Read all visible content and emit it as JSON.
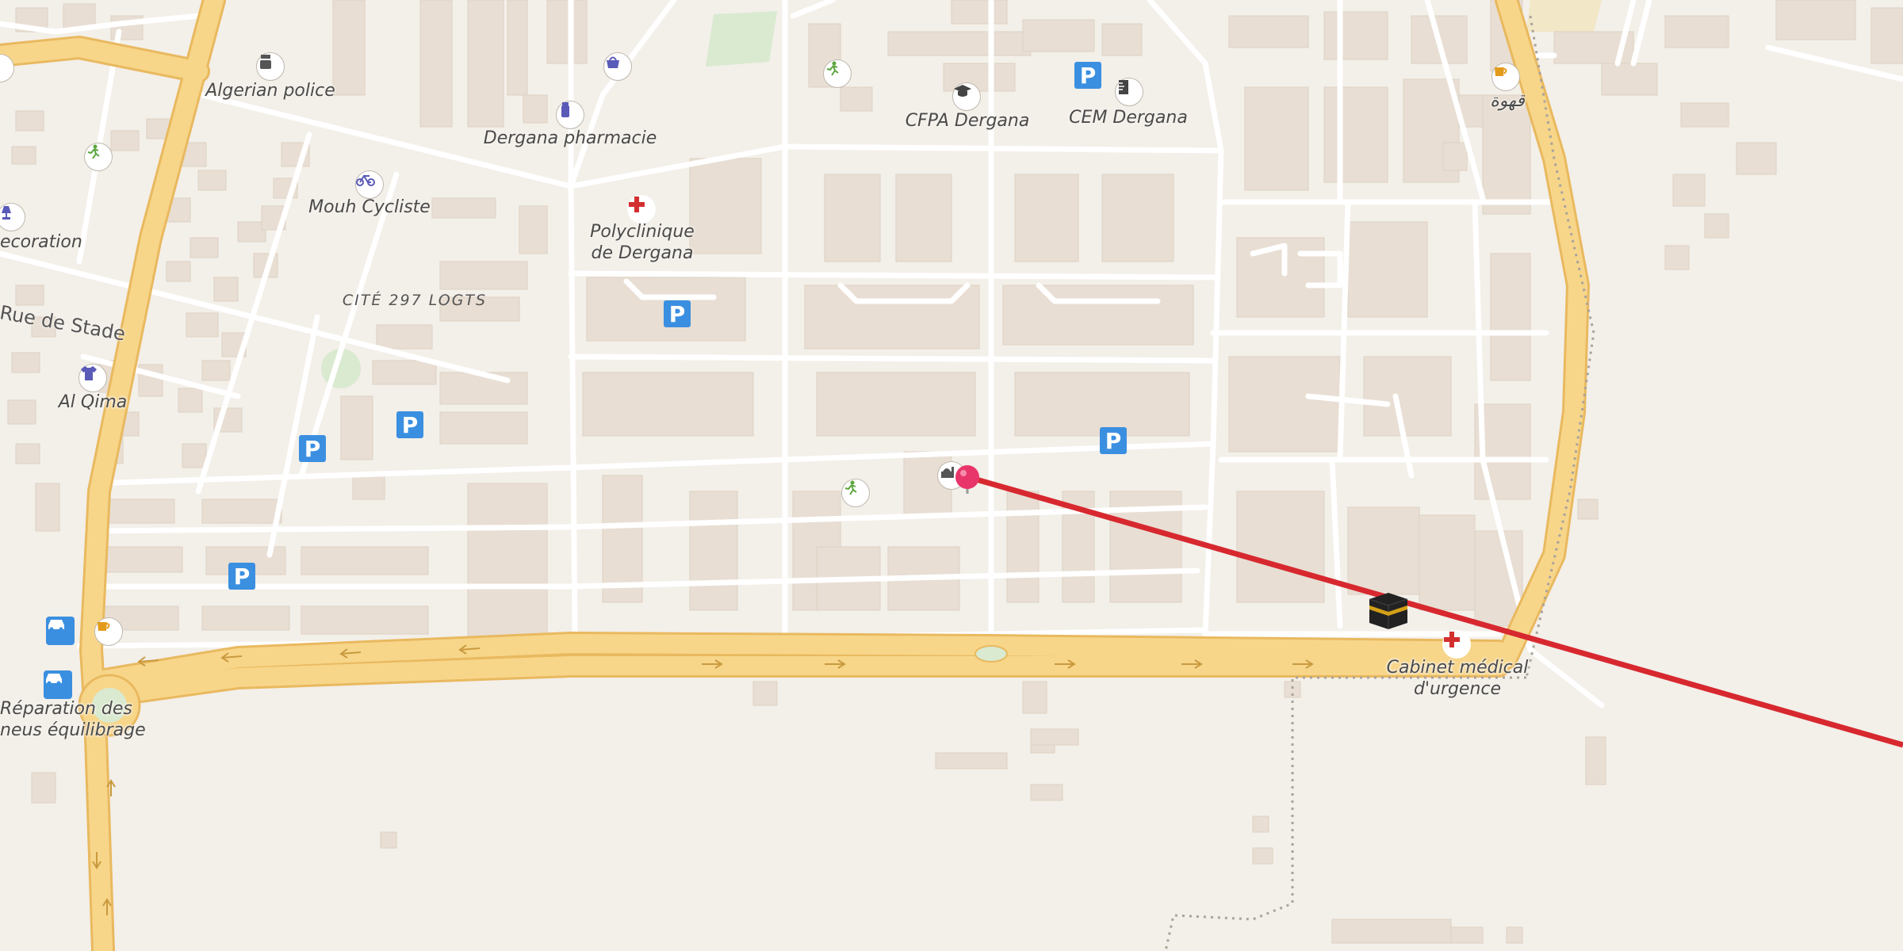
{
  "map": {
    "district_label": "CITÉ 297 LOGTS",
    "road_label": "Rue de Stade",
    "places": {
      "algerian_police": "Algerian police",
      "dergana_pharmacie": "Dergana pharmacie",
      "mouh_cycliste": "Mouh Cycliste",
      "polyclinique_line1": "Polyclinique",
      "polyclinique_line2": "de Dergana",
      "cfpa": "CFPA Dergana",
      "cem": "CEM Dergana",
      "cafe_arabic": "قهوة",
      "decoration": "ecoration",
      "al_qima": "Al Qima",
      "reparation_line1": "Réparation des",
      "reparation_line2": "neus équilibrage",
      "cabinet_line1": "Cabinet médical",
      "cabinet_line2": "d'urgence"
    },
    "icons": {
      "police": "police-icon",
      "pharmacy": "pharmacy-icon",
      "bicycle": "bicycle-icon",
      "clinic": "medical-cross-icon",
      "school": "graduation-cap-icon",
      "college": "ruler-icon",
      "cafe": "coffee-cup-icon",
      "lamp": "lamp-icon",
      "clothes": "shirt-icon",
      "sport": "running-person-icon",
      "shop": "shopping-basket-icon",
      "parking": "parking-icon",
      "car_repair": "car-icon",
      "mosque": "mosque-icon",
      "location_pin": "location-pin-icon",
      "qibla": "kaaba-icon"
    },
    "parking_letter": "P",
    "colors": {
      "background": "#f3efe9",
      "building": "#e8ded3",
      "major_road": "#f7d68a",
      "major_road_casing": "#e9b95f",
      "minor_road": "#ffffff",
      "qibla_line": "#d7282f",
      "pin": "#e8366a",
      "parking": "#3b8fe0",
      "park": "#d9ead0"
    }
  }
}
